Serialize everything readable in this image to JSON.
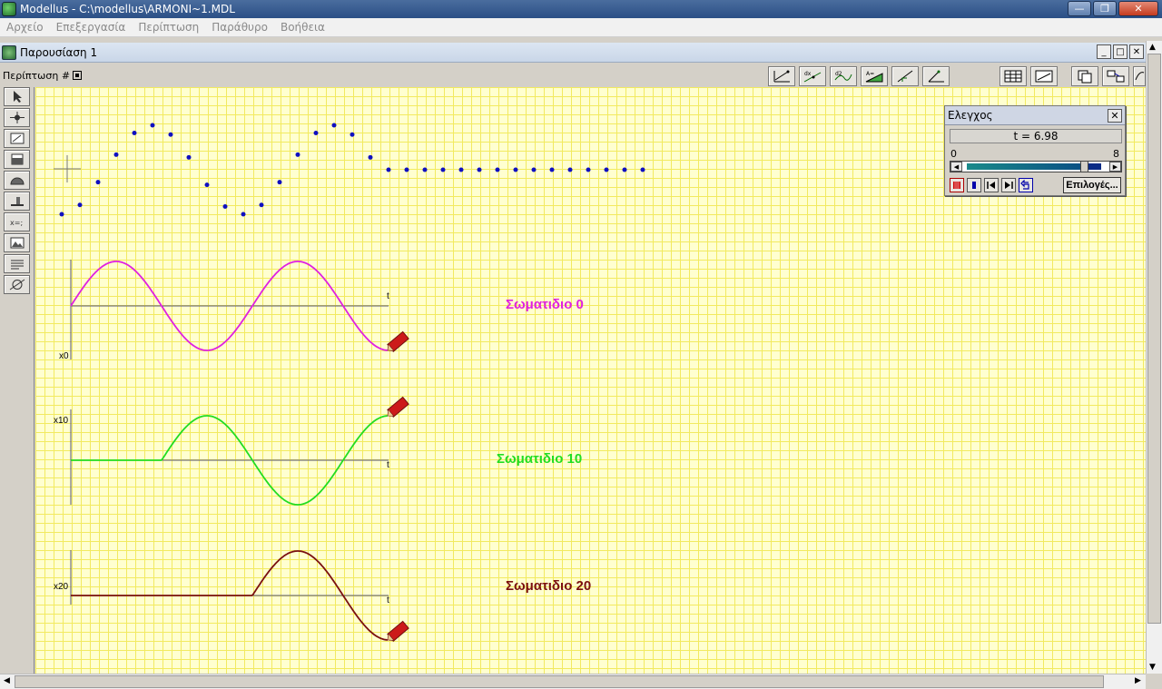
{
  "window": {
    "title": "Modellus - C:\\modellus\\ARMONI~1.MDL",
    "minimize": "—",
    "maximize": "❐",
    "close": "✕"
  },
  "menu": [
    "Αρχείο",
    "Επεξεργασία",
    "Περίπτωση",
    "Παράθυρο",
    "Βοήθεια"
  ],
  "child_window": {
    "title": "Παρουσίαση 1",
    "minimize": "_",
    "maximize": "□",
    "close": "✕"
  },
  "case_label": "Περίπτωση #",
  "control_panel": {
    "title": "Ελεγχος",
    "close": "✕",
    "time_label": "t =  6.98",
    "t": 6.98,
    "slider_min": "0",
    "slider_max": "8",
    "options_button": "Επιλογές..."
  },
  "graphs": [
    {
      "name": "x0",
      "axis_label": "x0",
      "t_label": "t",
      "particle_label": "Σωματιδιο 0",
      "color": "#e020e0"
    },
    {
      "name": "x10",
      "axis_label": "x10",
      "t_label": "t",
      "particle_label": "Σωματιδιο 10",
      "color": "#22dd22"
    },
    {
      "name": "x20",
      "axis_label": "x20",
      "t_label": "t",
      "particle_label": "Σωματιδιο 20",
      "color": "#7a1010"
    }
  ],
  "colors": {
    "canvas_bg": "#ffffd0",
    "grid": "#f2ea60",
    "dots": "#1010c0",
    "axis": "#555577"
  },
  "icons": {
    "left_tools": [
      "pointer-icon",
      "particle-icon",
      "vector-icon",
      "bar-icon",
      "meter-icon",
      "slider-tool-icon",
      "equation-icon",
      "image-icon",
      "text-icon",
      "measure-icon"
    ],
    "top_tools": [
      "graph-xy-icon",
      "graph-dx-icon",
      "graph-d2x-icon",
      "graph-area-icon",
      "graph-slope-icon",
      "graph-angle-icon",
      "table-icon",
      "graph-window-icon",
      "copy-icon",
      "arrange-icon",
      "extra-icon"
    ]
  }
}
